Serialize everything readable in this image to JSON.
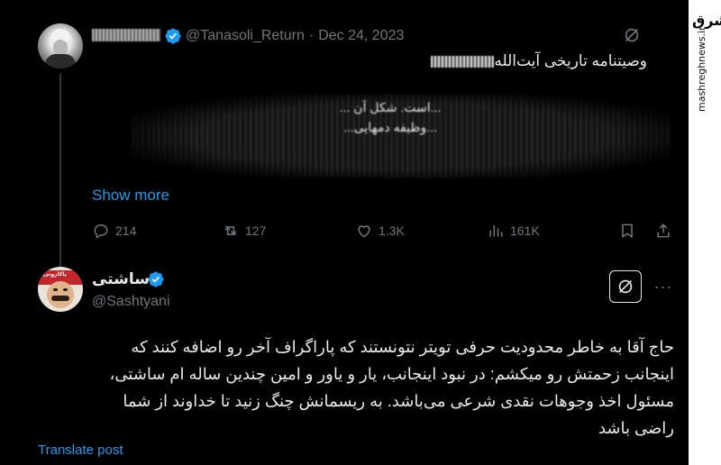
{
  "quoted_tweet": {
    "display_name": "",
    "handle": "@Tanasoli_Return",
    "separator": "·",
    "date": "Dec 24, 2023",
    "title": "وصیتنامه تاریخی آیت‌الله",
    "image_text": [
      "...است. شکل آن ...",
      "...وظیفه دمهایی..."
    ],
    "show_more_label": "Show more",
    "stats": {
      "replies": "214",
      "reposts": "127",
      "likes": "1.3K",
      "views": "161K"
    }
  },
  "main_tweet": {
    "display_name": "ساشتی",
    "handle": "@Sashtyani",
    "avatar_cap_text": "پاکاروتی",
    "text_lines": [
      "حاج آقا به خاطر محدودیت حرفی تویتر نتونستند که پاراگراف آخر رو اضافه کنند که",
      "اینجانب زحمتش رو میکشم: در نبود اینجانب، یار و یاور و امین چندین ساله ام ساشتی،",
      "مسئول اخذ وجوهات نقدی شرعی می‌باشد. به ریسمانش چنگ زنید تا خداوند از شما",
      "راضی باشد"
    ],
    "translate_label": "Translate post",
    "more_label": "···"
  },
  "watermark": {
    "logo": "مشرق",
    "url": "mashreghnews.ir"
  },
  "colors": {
    "background": "#000000",
    "text_primary": "#e7e9ea",
    "text_secondary": "#71767b",
    "accent": "#1d9bf0"
  },
  "icons": [
    "verified-badge-icon",
    "grok-icon",
    "reply-icon",
    "repost-icon",
    "like-icon",
    "views-icon",
    "bookmark-icon",
    "share-icon",
    "more-icon"
  ]
}
